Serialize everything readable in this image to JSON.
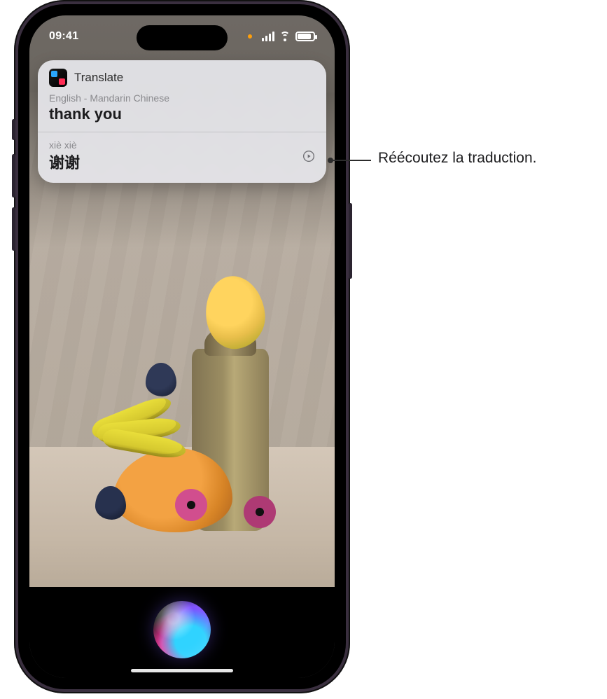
{
  "status": {
    "time": "09:41"
  },
  "card": {
    "title": "Translate",
    "language_pair": "English - Mandarin Chinese",
    "source_text": "thank you",
    "result": {
      "pinyin": "xiè xiè",
      "chinese": "谢谢"
    },
    "icons": {
      "play": "play-icon"
    }
  },
  "callout": {
    "text": "Réécoutez la traduction."
  }
}
